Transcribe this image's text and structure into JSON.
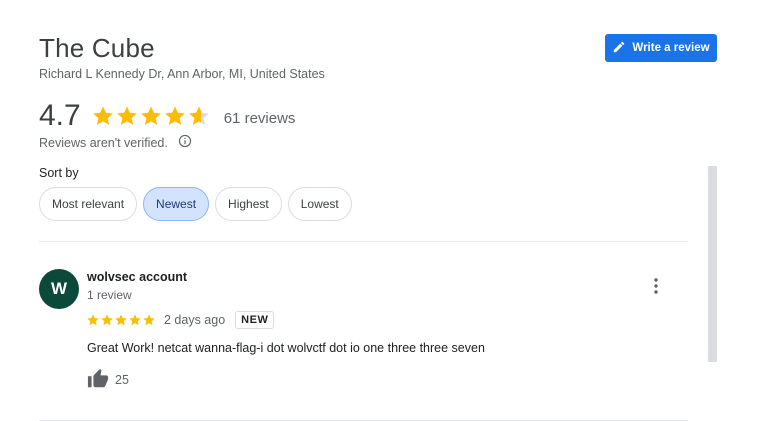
{
  "place": {
    "title": "The Cube",
    "address": "Richard L Kennedy Dr, Ann Arbor, MI, United States"
  },
  "header": {
    "write_review_label": "Write a review",
    "write_review_icon": "pencil-icon"
  },
  "summary": {
    "rating": "4.7",
    "stars_filled_fraction": 0.94,
    "review_count": "61 reviews",
    "verified_note": "Reviews aren't verified."
  },
  "sort": {
    "label": "Sort by",
    "options": [
      "Most relevant",
      "Newest",
      "Highest",
      "Lowest"
    ],
    "selected": "Newest"
  },
  "review": {
    "avatar_letter": "W",
    "reviewer_name": "wolvsec account",
    "reviewer_meta": "1 review",
    "stars": 5,
    "date": "2 days ago",
    "badge": "NEW",
    "text": "Great Work! netcat wanna-flag-i dot wolvctf dot io one three three seven",
    "likes": "25"
  },
  "colors": {
    "accent": "#1a73e8",
    "star": "#fbbc04",
    "star_empty": "#dadce0",
    "avatar_bg": "#0b4a3a",
    "chip_active_bg": "#d3e3fd"
  }
}
